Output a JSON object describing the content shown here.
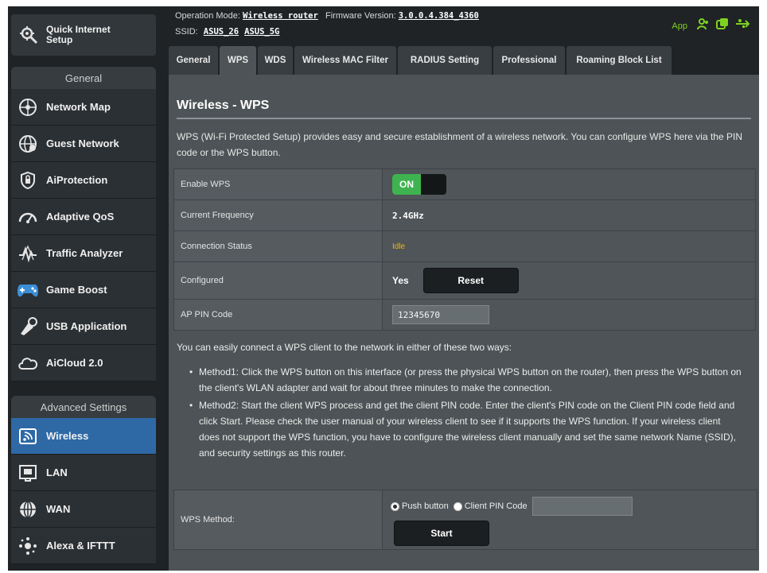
{
  "sidebar": {
    "quick_setup": "Quick Internet Setup",
    "general_header": "General",
    "general_items": [
      {
        "label": "Network Map",
        "icon": "network-map-icon"
      },
      {
        "label": "Guest Network",
        "icon": "guest-network-icon"
      },
      {
        "label": "AiProtection",
        "icon": "aiprotection-icon"
      },
      {
        "label": "Adaptive QoS",
        "icon": "adaptive-qos-icon"
      },
      {
        "label": "Traffic Analyzer",
        "icon": "traffic-analyzer-icon"
      },
      {
        "label": "Game Boost",
        "icon": "game-boost-icon"
      },
      {
        "label": "USB Application",
        "icon": "usb-application-icon"
      },
      {
        "label": "AiCloud 2.0",
        "icon": "aicloud-icon"
      }
    ],
    "advanced_header": "Advanced Settings",
    "advanced_items": [
      {
        "label": "Wireless",
        "icon": "wireless-icon",
        "active": true
      },
      {
        "label": "LAN",
        "icon": "lan-icon"
      },
      {
        "label": "WAN",
        "icon": "wan-icon"
      },
      {
        "label": "Alexa & IFTTT",
        "icon": "alexa-ifttt-icon"
      }
    ]
  },
  "header": {
    "operation_mode_label": "Operation Mode:",
    "operation_mode": "Wireless router",
    "firmware_label": "Firmware Version:",
    "firmware": "3.0.0.4.384_4360",
    "ssid_label": "SSID:",
    "ssid_1": "ASUS_26",
    "ssid_2": "ASUS_5G",
    "app_label": "App",
    "accent": "#7ed321"
  },
  "tabs": [
    "General",
    "WPS",
    "WDS",
    "Wireless MAC Filter",
    "RADIUS Setting",
    "Professional",
    "Roaming Block List"
  ],
  "active_tab": "WPS",
  "main": {
    "title": "Wireless - WPS",
    "description": "WPS (Wi-Fi Protected Setup) provides easy and secure establishment of a wireless network. You can configure WPS here via the PIN code or the WPS button.",
    "settings": {
      "enable_wps_label": "Enable WPS",
      "enable_wps_value": "ON",
      "current_frequency_label": "Current Frequency",
      "current_frequency_value": "2.4GHz",
      "connection_status_label": "Connection Status",
      "connection_status_value": "Idle",
      "configured_label": "Configured",
      "configured_value": "Yes",
      "reset_label": "Reset",
      "ap_pin_label": "AP PIN Code",
      "ap_pin_value": "12345670"
    },
    "info_text": "You can easily connect a WPS client to the network in either of these two ways:",
    "method1": "Method1: Click the WPS button on this interface (or press the physical WPS button on the router), then press the WPS button on the client's WLAN adapter and wait for about three minutes to make the connection.",
    "method2": "Method2: Start the client WPS process and get the client PIN code. Enter the client's PIN code on the Client PIN code field and click Start. Please check the user manual of your wireless client to see if it supports the WPS function. If your wireless client does not support the WPS function, you have to configure the wireless client manually and set the same network Name (SSID), and security settings as this router.",
    "wps_method_label": "WPS Method:",
    "push_button_label": "Push button",
    "client_pin_label": "Client PIN Code",
    "client_pin_value": "",
    "start_label": "Start"
  },
  "colors": {
    "active_menu": "#2e69a6",
    "toggle_on": "#3fb34f",
    "status_idle": "#f5b800"
  }
}
